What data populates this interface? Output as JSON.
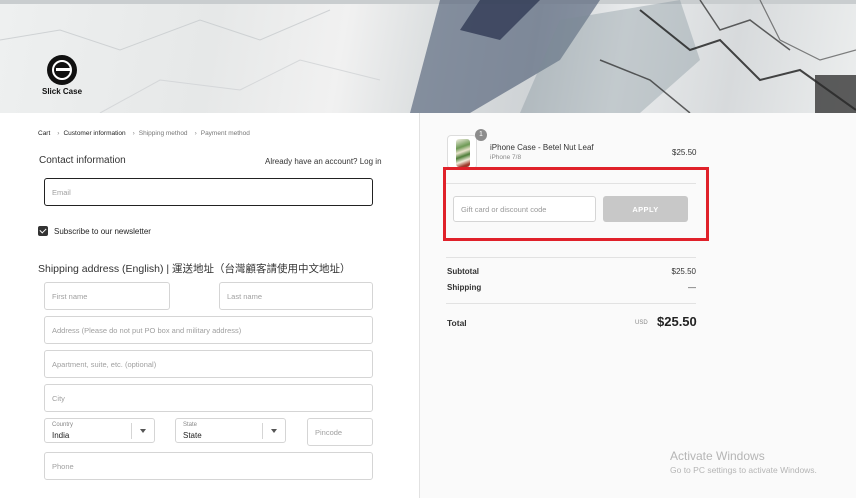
{
  "brand": {
    "name": "Slick Case"
  },
  "breadcrumb": [
    {
      "label": "Cart",
      "state": "link"
    },
    {
      "label": "Customer information",
      "state": "current"
    },
    {
      "label": "Shipping method",
      "state": "upcoming"
    },
    {
      "label": "Payment method",
      "state": "upcoming"
    }
  ],
  "contact": {
    "title": "Contact information",
    "login_prompt": "Already have an account? Log in",
    "email_placeholder": "Email",
    "newsletter_label": "Subscribe to our newsletter",
    "newsletter_checked": true
  },
  "shipping": {
    "title": "Shipping address (English) | 運送地址（台灣顧客請使用中文地址）",
    "first_name_placeholder": "First name",
    "last_name_placeholder": "Last name",
    "address_placeholder": "Address (Please do not put PO box and military address)",
    "apartment_placeholder": "Apartment, suite, etc. (optional)",
    "city_placeholder": "City",
    "country_label": "Country",
    "country_value": "India",
    "state_label": "State",
    "state_value": "State",
    "pincode_placeholder": "Pincode",
    "phone_placeholder": "Phone"
  },
  "order": {
    "item": {
      "quantity": "1",
      "name": "iPhone Case - Betel Nut Leaf",
      "variant": "iPhone 7/8",
      "price": "$25.50"
    },
    "discount_placeholder": "Gift card or discount code",
    "apply_label": "APPLY",
    "subtotal_label": "Subtotal",
    "subtotal_value": "$25.50",
    "shipping_label": "Shipping",
    "shipping_value": "—",
    "total_label": "Total",
    "currency": "USD",
    "total_value": "$25.50"
  },
  "watermark": {
    "title": "Activate Windows",
    "subtitle": "Go to PC settings to activate Windows."
  },
  "colors": {
    "highlight_box": "#e0212a",
    "apply_button": "#c8c8c8"
  }
}
